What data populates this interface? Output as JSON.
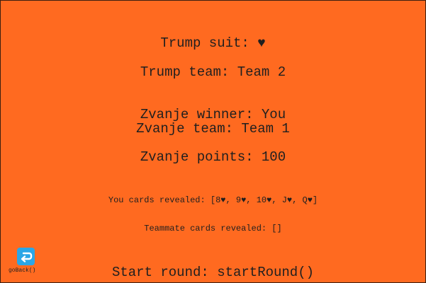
{
  "status": {
    "trump_suit": "Trump suit: ♥",
    "trump_team": "Trump team: Team 2",
    "zvanje_winner": "Zvanje winner: You",
    "zvanje_team": "Zvanje team: Team 1",
    "zvanje_points": "Zvanje points: 100",
    "you_cards": "You cards revealed: [8♥, 9♥, 10♥, J♥, Q♥]",
    "teammate_cards": "Teammate cards revealed: []"
  },
  "actions": {
    "start_round": "Start round: startRound()",
    "go_back_label": "goBack()",
    "go_back_icon": "return-arrow-icon"
  },
  "colors": {
    "background": "#ff6a20",
    "text": "#1f1f1f",
    "back_button": "#2ba6e6"
  }
}
